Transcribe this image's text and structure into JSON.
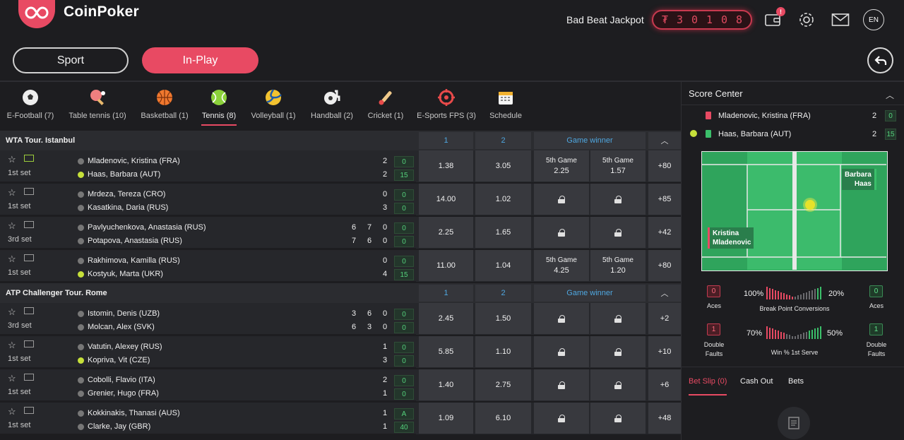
{
  "header": {
    "brand": "CoinPoker",
    "jackpot_label": "Bad Beat Jackpot",
    "jackpot_digits": [
      "₮",
      "3",
      "0",
      "1",
      "0",
      "8"
    ],
    "notif_badge": "!",
    "lang": "EN"
  },
  "mode": {
    "sport": "Sport",
    "inplay": "In-Play"
  },
  "sports": [
    {
      "label": "E-Football (7)",
      "icon": "soccer-ball-icon"
    },
    {
      "label": "Table tennis (10)",
      "icon": "ping-pong-icon"
    },
    {
      "label": "Basketball (1)",
      "icon": "basketball-icon"
    },
    {
      "label": "Tennis (8)",
      "icon": "tennis-ball-icon"
    },
    {
      "label": "Volleyball (1)",
      "icon": "volleyball-icon"
    },
    {
      "label": "Handball (2)",
      "icon": "handball-icon"
    },
    {
      "label": "Cricket (1)",
      "icon": "cricket-icon"
    },
    {
      "label": "E-Sports FPS (3)",
      "icon": "crosshair-icon"
    },
    {
      "label": "Schedule",
      "icon": "calendar-icon"
    }
  ],
  "colors": {
    "accent": "#e84a63",
    "odds_header": "#4fa7e0",
    "points_green": "#54d07b"
  },
  "sections": [
    {
      "title": "WTA Tour. Istanbul",
      "col1": "1",
      "col2": "2",
      "col3": "Game winner",
      "matches": [
        {
          "set": "1st set",
          "p1": "Mladenovic, Kristina (FRA)",
          "p2": "Haas, Barbara (AUT)",
          "serve": 2,
          "p1_sets": [
            "2"
          ],
          "p2_sets": [
            "2"
          ],
          "p1_pts": "0",
          "p2_pts": "15",
          "o1": "1.38",
          "o2": "3.05",
          "gw": [
            {
              "l": "5th Game",
              "v": "2.25"
            },
            {
              "l": "5th Game",
              "v": "1.57"
            }
          ],
          "more": "+80",
          "field_on": true
        },
        {
          "set": "1st set",
          "p1": "Mrdeza, Tereza (CRO)",
          "p2": "Kasatkina, Daria (RUS)",
          "serve": 0,
          "p1_sets": [
            "0"
          ],
          "p2_sets": [
            "3"
          ],
          "p1_pts": "0",
          "p2_pts": "0",
          "o1": "14.00",
          "o2": "1.02",
          "gw": null,
          "more": "+85",
          "field_on": false
        },
        {
          "set": "3rd set",
          "p1": "Pavlyuchenkova, Anastasia (RUS)",
          "p2": "Potapova, Anastasia (RUS)",
          "serve": 0,
          "p1_sets": [
            "6",
            "7",
            "0"
          ],
          "p2_sets": [
            "7",
            "6",
            "0"
          ],
          "p1_pts": "0",
          "p2_pts": "0",
          "o1": "2.25",
          "o2": "1.65",
          "gw": null,
          "more": "+42",
          "field_on": false
        },
        {
          "set": "1st set",
          "p1": "Rakhimova, Kamilla (RUS)",
          "p2": "Kostyuk, Marta (UKR)",
          "serve": 2,
          "p1_sets": [
            "0"
          ],
          "p2_sets": [
            "4"
          ],
          "p1_pts": "0",
          "p2_pts": "15",
          "o1": "11.00",
          "o2": "1.04",
          "gw": [
            {
              "l": "5th Game",
              "v": "4.25"
            },
            {
              "l": "5th Game",
              "v": "1.20"
            }
          ],
          "more": "+80",
          "field_on": false
        }
      ]
    },
    {
      "title": "ATP Challenger Tour. Rome",
      "col1": "1",
      "col2": "2",
      "col3": "Game winner",
      "matches": [
        {
          "set": "3rd set",
          "p1": "Istomin, Denis (UZB)",
          "p2": "Molcan, Alex (SVK)",
          "serve": 0,
          "p1_sets": [
            "3",
            "6",
            "0"
          ],
          "p2_sets": [
            "6",
            "3",
            "0"
          ],
          "p1_pts": "0",
          "p2_pts": "0",
          "o1": "2.45",
          "o2": "1.50",
          "gw": null,
          "more": "+2",
          "field_on": false
        },
        {
          "set": "1st set",
          "p1": "Vatutin, Alexey (RUS)",
          "p2": "Kopriva, Vit (CZE)",
          "serve": 2,
          "p1_sets": [
            "1"
          ],
          "p2_sets": [
            "3"
          ],
          "p1_pts": "0",
          "p2_pts": "0",
          "o1": "5.85",
          "o2": "1.10",
          "gw": null,
          "more": "+10",
          "field_on": false
        },
        {
          "set": "1st set",
          "p1": "Cobolli, Flavio (ITA)",
          "p2": "Grenier, Hugo (FRA)",
          "serve": 0,
          "p1_sets": [
            "2"
          ],
          "p2_sets": [
            "1"
          ],
          "p1_pts": "0",
          "p2_pts": "0",
          "o1": "1.40",
          "o2": "2.75",
          "gw": null,
          "more": "+6",
          "field_on": false
        },
        {
          "set": "1st set",
          "p1": "Kokkinakis, Thanasi (AUS)",
          "p2": "Clarke, Jay (GBR)",
          "serve": 0,
          "p1_sets": [
            "1"
          ],
          "p2_sets": [
            "1"
          ],
          "p1_pts": "A",
          "p2_pts": "40",
          "o1": "1.09",
          "o2": "6.10",
          "gw": null,
          "more": "+48",
          "field_on": false
        }
      ]
    }
  ],
  "score_center": {
    "title": "Score Center",
    "p1": {
      "name": "Mladenovic, Kristina (FRA)",
      "sets": "2",
      "game": "0",
      "shirt": "#e84a63"
    },
    "p2": {
      "name": "Haas, Barbara (AUT)",
      "sets": "2",
      "game": "15",
      "shirt": "#3bbf6a"
    },
    "court_p1": [
      "Kristina",
      "Mladenovic"
    ],
    "court_p2": [
      "Barbara",
      "Haas"
    ],
    "stats": {
      "aces_label": "Aces",
      "aces_p1": "0",
      "aces_p2": "0",
      "bp_label": "Break Point Conversions",
      "bp_p1": "100%",
      "bp_p2": "20%",
      "df_label": [
        "Double",
        "Faults"
      ],
      "df_p1": "1",
      "df_p2": "1",
      "fs_label": "Win % 1st Serve",
      "fs_p1": "70%",
      "fs_p2": "50%"
    }
  },
  "betslip": {
    "tabs": [
      "Bet Slip (0)",
      "Cash Out",
      "Bets"
    ]
  }
}
